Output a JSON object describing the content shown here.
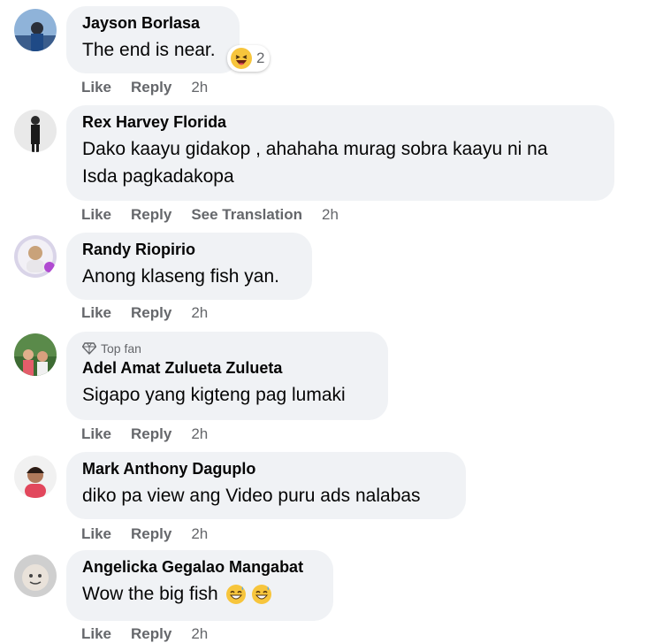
{
  "comments": [
    {
      "name": "Jayson Borlasa",
      "text": "The end is near.",
      "actions": {
        "like": "Like",
        "reply": "Reply",
        "time": "2h"
      },
      "reaction": {
        "icon": "haha-emoji",
        "count": "2"
      }
    },
    {
      "name": "Rex Harvey Florida",
      "text_line1": "Dako kaayu gidakop , ahahaha murag sobra kaayu ni na",
      "text_line2": "Isda pagkadakopa",
      "actions": {
        "like": "Like",
        "reply": "Reply",
        "translate": "See Translation",
        "time": "2h"
      }
    },
    {
      "name": "Randy Riopirio",
      "text": "Anong klaseng fish yan.",
      "actions": {
        "like": "Like",
        "reply": "Reply",
        "time": "2h"
      }
    },
    {
      "badge": "Top fan",
      "name": "Adel Amat Zulueta Zulueta",
      "text": "Sigapo yang kigteng pag lumaki",
      "actions": {
        "like": "Like",
        "reply": "Reply",
        "time": "2h"
      }
    },
    {
      "name": "Mark Anthony Daguplo",
      "text": "diko pa view ang Video puru ads nalabas",
      "actions": {
        "like": "Like",
        "reply": "Reply",
        "time": "2h"
      }
    },
    {
      "name": "Angelicka Gegalao Mangabat",
      "text": "Wow the big fish",
      "emoji": "grinning-sweat-emoji",
      "actions": {
        "like": "Like",
        "reply": "Reply",
        "time": "2h"
      }
    }
  ],
  "colors": {
    "bubble": "#f0f2f5",
    "meta": "#65676b",
    "text": "#050505",
    "emoji": "#f7c53c"
  }
}
